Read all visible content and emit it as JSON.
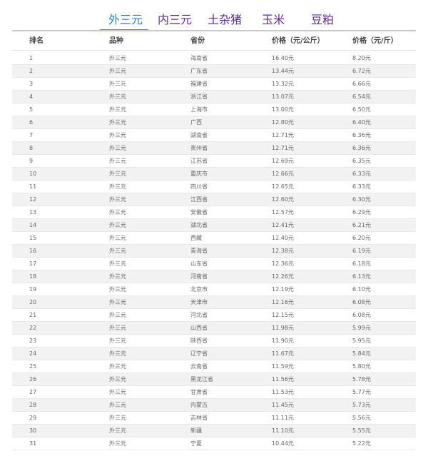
{
  "tabs": [
    "外三元",
    "内三元",
    "土杂猪",
    "玉米",
    "豆粕"
  ],
  "table": {
    "headers": [
      "排名",
      "品种",
      "省份",
      "价格（元/公斤）",
      "价格（元/斤）"
    ],
    "rows": [
      {
        "rank": "1",
        "variety": "外三元",
        "province": "海南省",
        "price_kg": "16.40元",
        "price_jin": "8.20元"
      },
      {
        "rank": "2",
        "variety": "外三元",
        "province": "广东省",
        "price_kg": "13.44元",
        "price_jin": "6.72元"
      },
      {
        "rank": "3",
        "variety": "外三元",
        "province": "福建省",
        "price_kg": "13.32元",
        "price_jin": "6.66元"
      },
      {
        "rank": "4",
        "variety": "外三元",
        "province": "浙江省",
        "price_kg": "13.07元",
        "price_jin": "6.54元"
      },
      {
        "rank": "5",
        "variety": "外三元",
        "province": "上海市",
        "price_kg": "13.00元",
        "price_jin": "6.50元"
      },
      {
        "rank": "6",
        "variety": "外三元",
        "province": "广西",
        "price_kg": "12.80元",
        "price_jin": "6.40元"
      },
      {
        "rank": "7",
        "variety": "外三元",
        "province": "湖南省",
        "price_kg": "12.71元",
        "price_jin": "6.36元"
      },
      {
        "rank": "8",
        "variety": "外三元",
        "province": "贵州省",
        "price_kg": "12.71元",
        "price_jin": "6.36元"
      },
      {
        "rank": "9",
        "variety": "外三元",
        "province": "江苏省",
        "price_kg": "12.69元",
        "price_jin": "6.35元"
      },
      {
        "rank": "10",
        "variety": "外三元",
        "province": "重庆市",
        "price_kg": "12.66元",
        "price_jin": "6.33元"
      },
      {
        "rank": "11",
        "variety": "外三元",
        "province": "四川省",
        "price_kg": "12.65元",
        "price_jin": "6.33元"
      },
      {
        "rank": "12",
        "variety": "外三元",
        "province": "江西省",
        "price_kg": "12.60元",
        "price_jin": "6.30元"
      },
      {
        "rank": "13",
        "variety": "外三元",
        "province": "安徽省",
        "price_kg": "12.57元",
        "price_jin": "6.29元"
      },
      {
        "rank": "14",
        "variety": "外三元",
        "province": "湖北省",
        "price_kg": "12.41元",
        "price_jin": "6.21元"
      },
      {
        "rank": "15",
        "variety": "外三元",
        "province": "西藏",
        "price_kg": "12.40元",
        "price_jin": "6.20元"
      },
      {
        "rank": "16",
        "variety": "外三元",
        "province": "青海省",
        "price_kg": "12.38元",
        "price_jin": "6.19元"
      },
      {
        "rank": "17",
        "variety": "外三元",
        "province": "山东省",
        "price_kg": "12.36元",
        "price_jin": "6.18元"
      },
      {
        "rank": "18",
        "variety": "外三元",
        "province": "河南省",
        "price_kg": "12.26元",
        "price_jin": "6.13元"
      },
      {
        "rank": "19",
        "variety": "外三元",
        "province": "北京市",
        "price_kg": "12.19元",
        "price_jin": "6.10元"
      },
      {
        "rank": "20",
        "variety": "外三元",
        "province": "天津市",
        "price_kg": "12.16元",
        "price_jin": "6.08元"
      },
      {
        "rank": "21",
        "variety": "外三元",
        "province": "河北省",
        "price_kg": "12.15元",
        "price_jin": "6.08元"
      },
      {
        "rank": "22",
        "variety": "外三元",
        "province": "山西省",
        "price_kg": "11.98元",
        "price_jin": "5.99元"
      },
      {
        "rank": "23",
        "variety": "外三元",
        "province": "陕西省",
        "price_kg": "11.90元",
        "price_jin": "5.95元"
      },
      {
        "rank": "24",
        "variety": "外三元",
        "province": "辽宁省",
        "price_kg": "11.67元",
        "price_jin": "5.84元"
      },
      {
        "rank": "25",
        "variety": "外三元",
        "province": "云南省",
        "price_kg": "11.59元",
        "price_jin": "5.80元"
      },
      {
        "rank": "26",
        "variety": "外三元",
        "province": "黑龙江省",
        "price_kg": "11.56元",
        "price_jin": "5.78元"
      },
      {
        "rank": "27",
        "variety": "外三元",
        "province": "甘肃省",
        "price_kg": "11.53元",
        "price_jin": "5.77元"
      },
      {
        "rank": "28",
        "variety": "外三元",
        "province": "内蒙古",
        "price_kg": "11.45元",
        "price_jin": "5.73元"
      },
      {
        "rank": "29",
        "variety": "外三元",
        "province": "吉林省",
        "price_kg": "11.11元",
        "price_jin": "5.56元"
      },
      {
        "rank": "30",
        "variety": "外三元",
        "province": "新疆",
        "price_kg": "11.10元",
        "price_jin": "5.55元"
      },
      {
        "rank": "31",
        "variety": "外三元",
        "province": "宁夏",
        "price_kg": "10.44元",
        "price_jin": "5.22元"
      }
    ]
  }
}
